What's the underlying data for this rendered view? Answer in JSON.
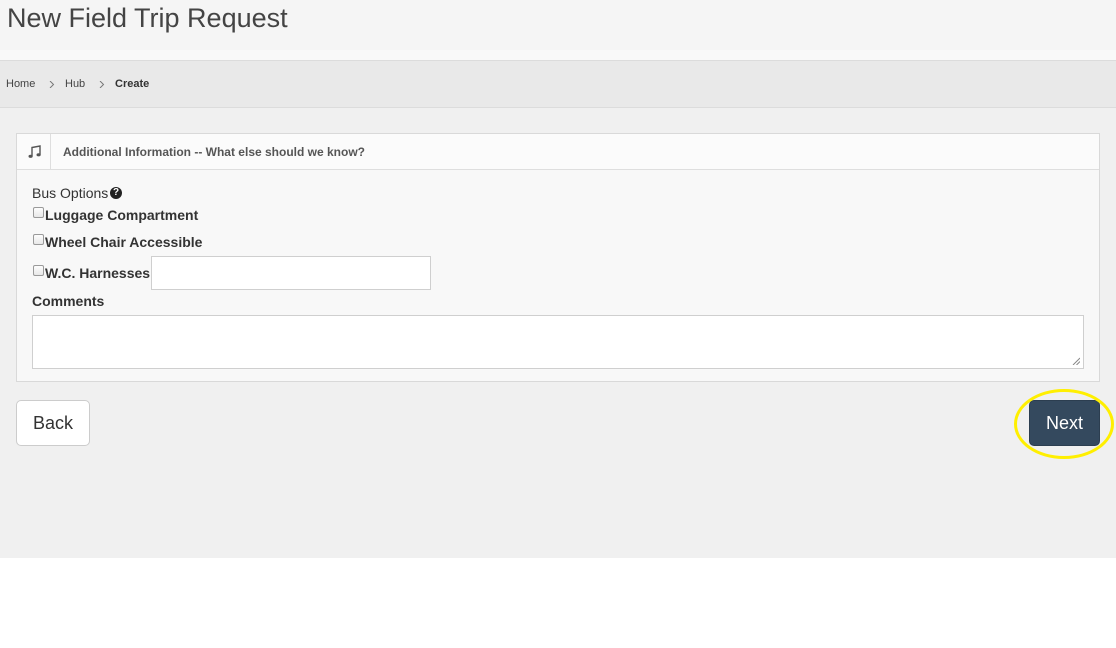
{
  "header": {
    "title": "New Field Trip Request"
  },
  "breadcrumb": {
    "items": [
      "Home",
      "Hub",
      "Create"
    ]
  },
  "panel": {
    "icon": "music-note-icon",
    "title": "Additional Information -- What else should we know?"
  },
  "bus_options": {
    "label": "Bus Options",
    "help_icon": "question-circle-icon",
    "options": [
      {
        "label": "Luggage Compartment",
        "checked": false
      },
      {
        "label": "Wheel Chair Accessible",
        "checked": false
      },
      {
        "label": "W.C. Harnesses",
        "checked": false,
        "value": ""
      }
    ]
  },
  "comments": {
    "label": "Comments",
    "value": ""
  },
  "actions": {
    "back_label": "Back",
    "next_label": "Next"
  },
  "colors": {
    "next_button": "#34495e",
    "highlight": "#ffef00"
  }
}
